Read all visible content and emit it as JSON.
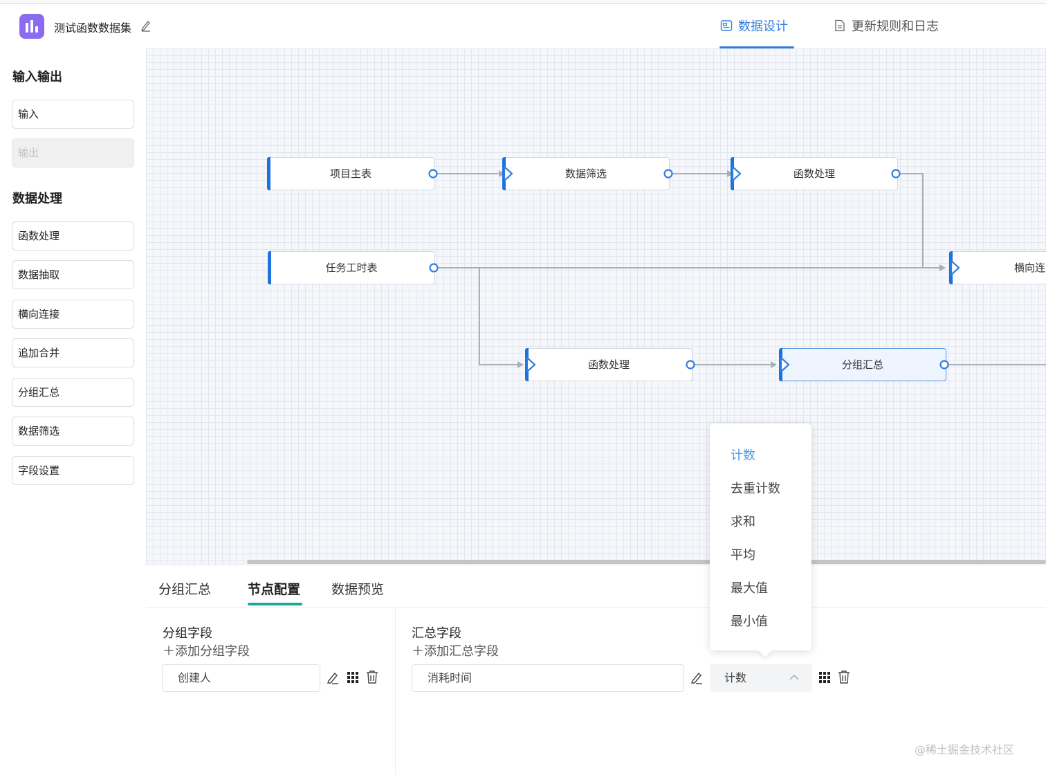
{
  "header": {
    "title": "测试函数数据集",
    "tabs": [
      {
        "label": "数据设计",
        "active": true
      },
      {
        "label": "更新规则和日志",
        "active": false
      }
    ]
  },
  "sidebar": {
    "sections": [
      {
        "title": "输入输出",
        "items": [
          {
            "label": "输入",
            "disabled": false
          },
          {
            "label": "输出",
            "disabled": true
          }
        ]
      },
      {
        "title": "数据处理",
        "items": [
          {
            "label": "函数处理"
          },
          {
            "label": "数据抽取"
          },
          {
            "label": "横向连接"
          },
          {
            "label": "追加合并"
          },
          {
            "label": "分组汇总"
          },
          {
            "label": "数据筛选"
          },
          {
            "label": "字段设置"
          }
        ]
      }
    ]
  },
  "canvas": {
    "nodes": [
      {
        "id": "n1",
        "label": "项目主表"
      },
      {
        "id": "n2",
        "label": "数据筛选"
      },
      {
        "id": "n3",
        "label": "函数处理"
      },
      {
        "id": "n4",
        "label": "任务工时表"
      },
      {
        "id": "n5",
        "label": "横向连"
      },
      {
        "id": "n6",
        "label": "函数处理"
      },
      {
        "id": "n7",
        "label": "分组汇总",
        "selected": true
      }
    ]
  },
  "panel": {
    "tabs": [
      {
        "label": "分组汇总",
        "active": false
      },
      {
        "label": "节点配置",
        "active": true
      },
      {
        "label": "数据预览",
        "active": false
      }
    ],
    "group": {
      "title": "分组字段",
      "add_label": "＋添加分组字段",
      "field": "创建人"
    },
    "summary": {
      "title": "汇总字段",
      "add_label": "＋添加汇总字段",
      "field": "消耗时间",
      "aggregate": "计数"
    }
  },
  "dropdown": {
    "options": [
      "计数",
      "去重计数",
      "求和",
      "平均",
      "最大值",
      "最小值"
    ],
    "selected": "计数"
  },
  "watermark": "@稀土掘金技术社区",
  "colors": {
    "accent": "#2f7fe0",
    "node_bar": "#1f72dd",
    "panel_tab": "#1ca79a",
    "logo": "#8b6cf0"
  }
}
